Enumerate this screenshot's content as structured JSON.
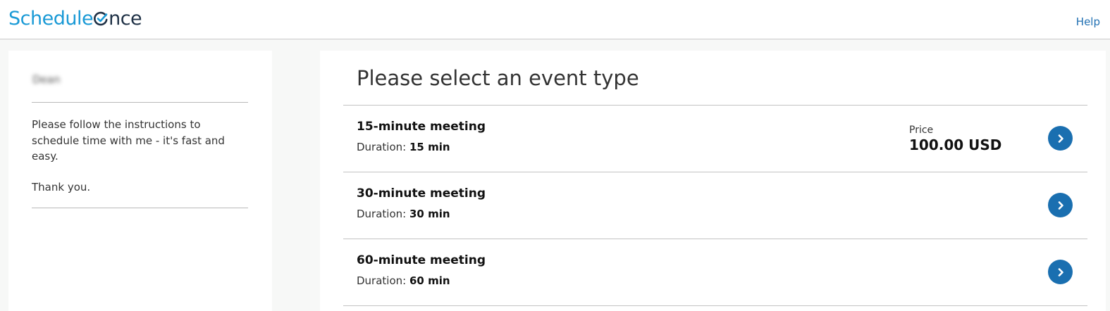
{
  "header": {
    "logo_part1": "Schedule",
    "logo_part2": "nce",
    "help_label": "Help"
  },
  "sidebar": {
    "host_name": "Dean",
    "intro": "Please follow the instructions to schedule time with me - it's fast and easy.",
    "thanks": "Thank you."
  },
  "main": {
    "title": "Please select an event type",
    "duration_prefix": "Duration:",
    "price_label": "Price",
    "events": [
      {
        "name": "15-minute meeting",
        "duration": "15 min",
        "price": "100.00 USD"
      },
      {
        "name": "30-minute meeting",
        "duration": "30 min"
      },
      {
        "name": "60-minute meeting",
        "duration": "60 min"
      }
    ]
  },
  "colors": {
    "brand_blue": "#1a9ad6",
    "brand_dark": "#1f3146",
    "button_blue": "#1a6fb0"
  },
  "icons": {
    "go": "chevron-right-icon",
    "logo_mark": "checkmark-o-icon"
  }
}
